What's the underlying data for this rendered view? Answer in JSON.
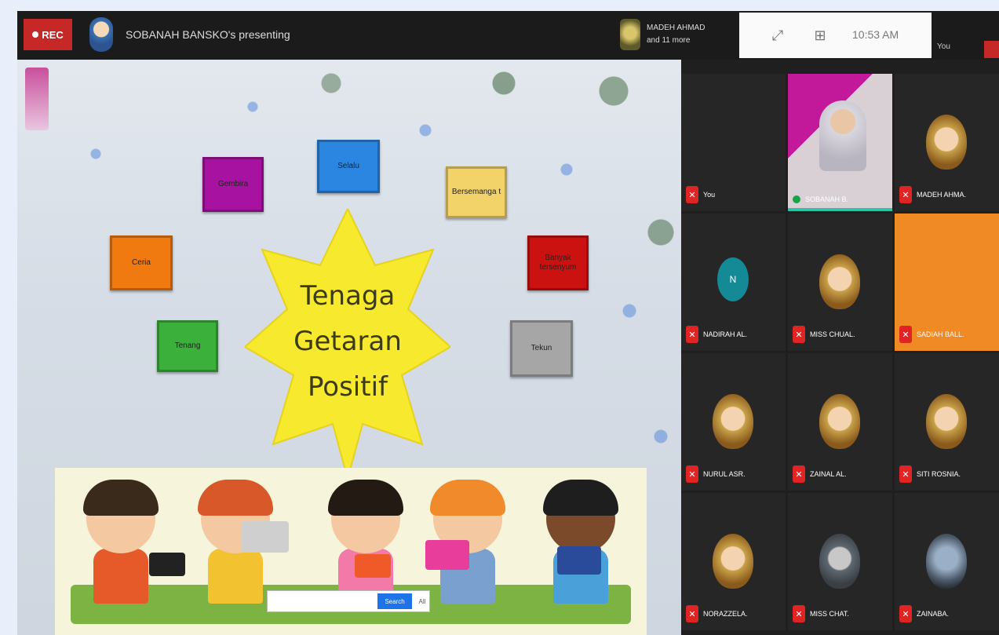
{
  "topbar": {
    "rec_label": "REC",
    "presenter_name": "SOBANAH BANSKO's presenting",
    "school_line1": "MADEH AHMAD",
    "school_line2": "and 11 more",
    "time": "10:53 AM",
    "host_label": "You"
  },
  "slide": {
    "logo_text": "",
    "boxes": [
      {
        "label": "Gembira",
        "color": "#a812a0"
      },
      {
        "label": "Selalu",
        "color": "#2a86e0"
      },
      {
        "label": "Bersemanga t",
        "color": "#f2d36a"
      },
      {
        "label": "Ceria",
        "color": "#f07a10"
      },
      {
        "label": "Banyak tersenyum",
        "color": "#cc1111"
      },
      {
        "label": "Tenang",
        "color": "#3bb03b"
      },
      {
        "label": "Tekun",
        "color": "#a6a6a6"
      }
    ],
    "star_lines": [
      "Tenaga",
      "Getaran",
      "Positif"
    ],
    "star_color": "#f7ea2e",
    "search": {
      "placeholder": "",
      "button": "Search",
      "extra": "All"
    }
  },
  "gallery": {
    "tiles": [
      {
        "name": "You",
        "type": "blank",
        "muted": true
      },
      {
        "name": "SOBANAH B.",
        "type": "video",
        "muted": false
      },
      {
        "name": "MADEH AHMA.",
        "type": "avatar",
        "muted": true
      },
      {
        "name": "NADIRAH AL.",
        "type": "teal",
        "initial": "N",
        "muted": true
      },
      {
        "name": "MISS CHUAL.",
        "type": "avatar",
        "muted": true
      },
      {
        "name": "SADIAH BALL.",
        "type": "orange",
        "muted": true
      },
      {
        "name": "NURUL ASR.",
        "type": "avatar",
        "muted": true
      },
      {
        "name": "ZAINAL AL.",
        "type": "avatar",
        "muted": true
      },
      {
        "name": "SITI ROSNIA.",
        "type": "avatar",
        "muted": true
      },
      {
        "name": "NORAZZELA.",
        "type": "avatar",
        "muted": true
      },
      {
        "name": "MISS CHAT.",
        "type": "gray",
        "muted": true
      },
      {
        "name": "ZAINABA.",
        "type": "blur",
        "muted": true
      }
    ]
  },
  "colors": {
    "rec": "#c62828",
    "muted_mic": "#e02424",
    "active_speaker": "#2ec4a8"
  },
  "icons": [
    "record-dot-icon",
    "presenter-avatar-icon",
    "school-crest-icon",
    "layout-icon",
    "participants-icon",
    "mic-muted-icon",
    "mic-on-icon"
  ]
}
